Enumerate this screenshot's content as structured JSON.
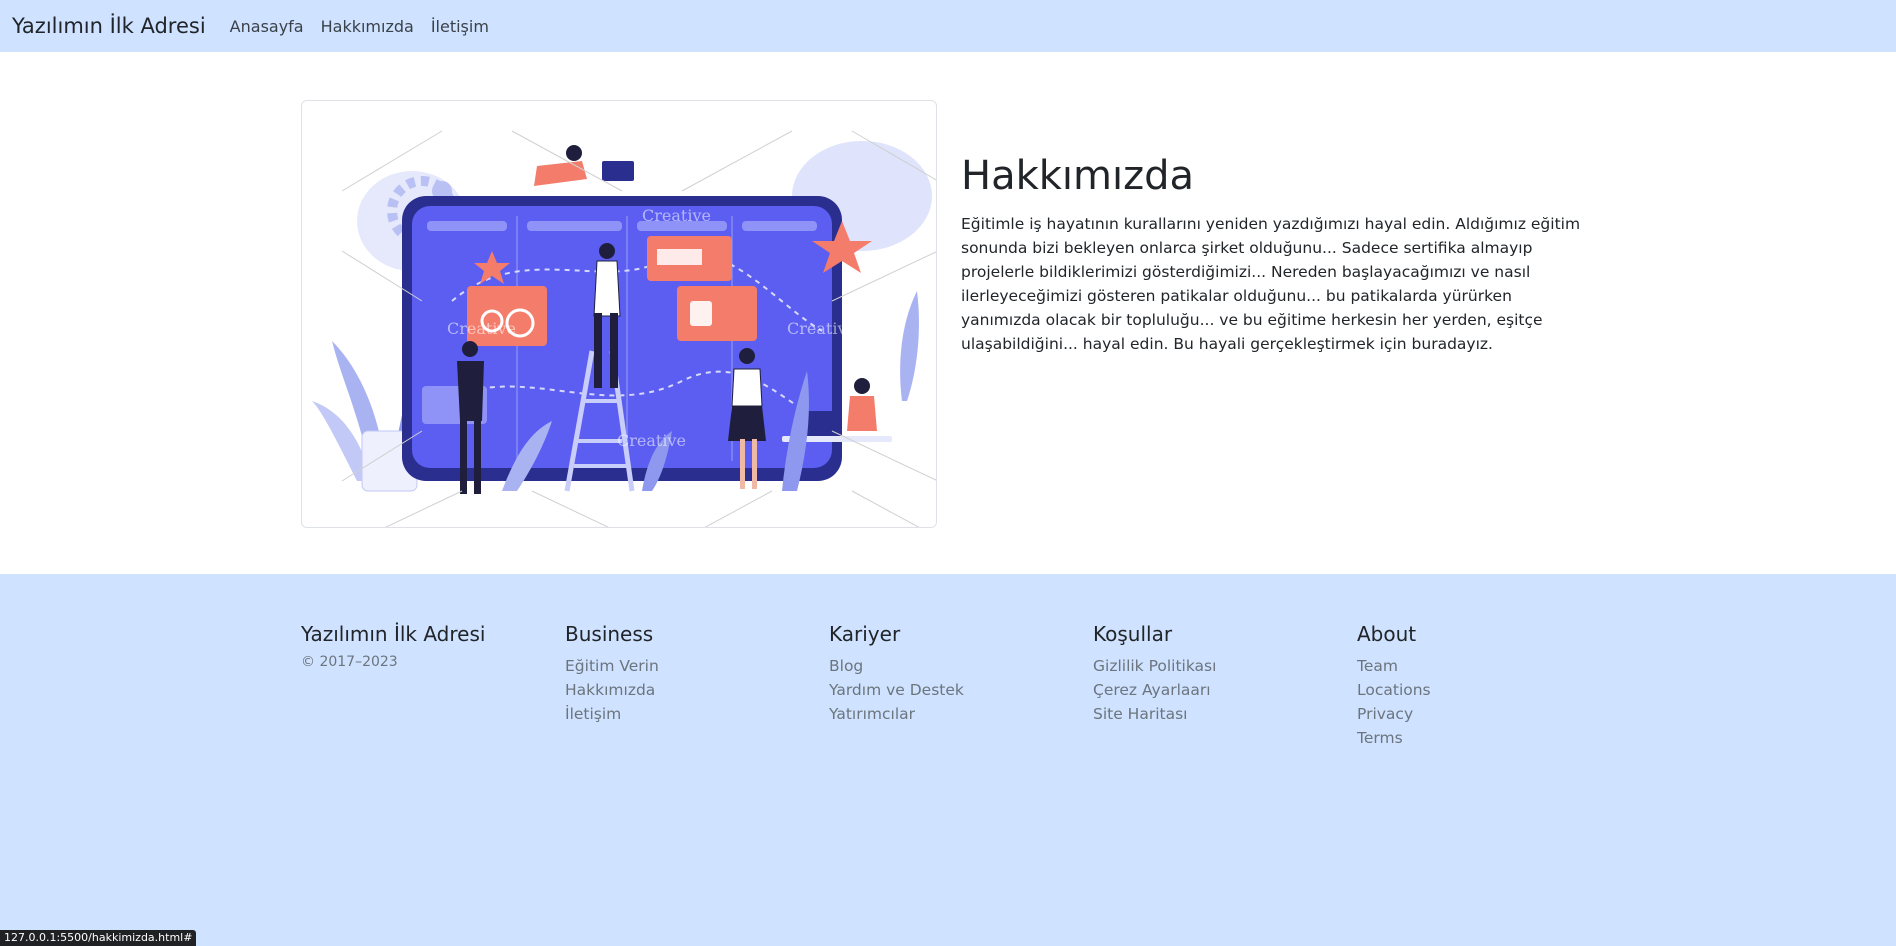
{
  "navbar": {
    "brand": "Yazılımın İlk Adresi",
    "links": [
      "Anasayfa",
      "Hakkımızda",
      "İletişim"
    ]
  },
  "hero": {
    "title": "Hakkımızda",
    "body": "Eğitimle iş hayatının kurallarını yeniden yazdığımızı hayal edin. Aldığımız eğitim sonunda bizi bekleyen onlarca şirket olduğunu... Sadece sertifika almayıp projelerle bildiklerimizi gösterdiğimizi... Nereden başlayacağımızı ve nasıl ilerleyeceğimizi gösteren patikalar olduğunu... bu patikalarda yürürken yanımızda olacak bir topluluğu... ve bu eğitime herkesin her yerden, eşitçe ulaşabildiğini... hayal edin. Bu hayali gerçekleştirmek için buradayız.",
    "watermark": "Creative"
  },
  "footer": {
    "brand": "Yazılımın İlk Adresi",
    "copyright": "© 2017–2023",
    "columns": [
      {
        "title": "Business",
        "items": [
          "Eğitim Verin",
          "Hakkımızda",
          "İletişim"
        ]
      },
      {
        "title": "Kariyer",
        "items": [
          "Blog",
          "Yardım ve Destek",
          "Yatırımcılar"
        ]
      },
      {
        "title": "Koşullar",
        "items": [
          "Gizlilik Politikası",
          "Çerez Ayarlaarı",
          "Site Haritası"
        ]
      },
      {
        "title": "About",
        "items": [
          "Team",
          "Locations",
          "Privacy",
          "Terms"
        ]
      }
    ]
  },
  "statusbar": {
    "url": "127.0.0.1:5500/hakkimizda.html#"
  },
  "colors": {
    "navbar_bg": "#cfe2ff",
    "footer_bg": "#cfe2ff",
    "illustration_blue": "#5b5ef0",
    "illustration_coral": "#f47c6a"
  }
}
